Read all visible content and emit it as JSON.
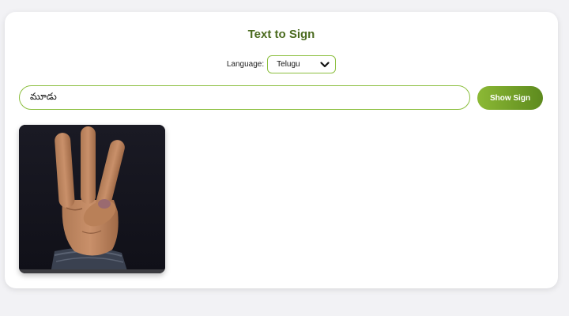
{
  "header": {
    "title": "Text to Sign"
  },
  "language": {
    "label": "Language:",
    "selected": "Telugu"
  },
  "input": {
    "value": "మూడు"
  },
  "action": {
    "label": "Show Sign"
  },
  "result": {
    "icon": "hand-sign-three"
  },
  "colors": {
    "accent": "#8cbf3f",
    "title": "#4b6b1f",
    "button_start": "#8cb935",
    "button_end": "#5d8a1e"
  }
}
